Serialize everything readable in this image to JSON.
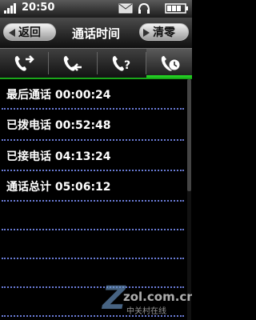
{
  "status": {
    "time": "20:50"
  },
  "header": {
    "back_label": "返回",
    "title": "通话时间",
    "clear_label": "清零"
  },
  "tabs": [
    {
      "icon": "outgoing-call-icon"
    },
    {
      "icon": "incoming-call-icon"
    },
    {
      "icon": "missed-call-icon"
    },
    {
      "icon": "call-timer-icon"
    }
  ],
  "list": {
    "rows": [
      {
        "label": "最后通话",
        "value": "00:00:24"
      },
      {
        "label": "已拨电话",
        "value": "00:52:48"
      },
      {
        "label": "已接电话",
        "value": "04:13:24"
      },
      {
        "label": "通话总计",
        "value": "05:06:12"
      }
    ]
  },
  "watermark": {
    "text": "zol.com.cn",
    "subtext": "中关村在线"
  },
  "colors": {
    "accent_green": "#22cc22",
    "separator": "#6a7cd6"
  }
}
